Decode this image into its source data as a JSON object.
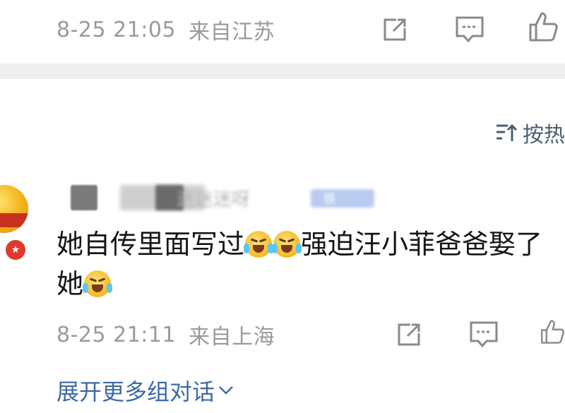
{
  "top_comment": {
    "date": "8-25 21:05",
    "location": "来自江苏"
  },
  "sort": {
    "label": "按热"
  },
  "comment": {
    "username": "迷迷迷呀",
    "tag": "铁粉",
    "text_line1": "她自传里面写过",
    "text_line1_tail": "强迫汪小菲爸爸娶了",
    "text_line2": "她",
    "date": "8-25 21:11",
    "location": "来自上海"
  },
  "expand_label": "展开更多组对话",
  "icons": {
    "share": "share-icon",
    "comment": "comment-icon",
    "like": "like-icon",
    "sort": "sort-icon",
    "emoji": "crying-laughing-emoji"
  },
  "colors": {
    "meta_text": "#9a9a9a",
    "link_blue": "#3d6aa6",
    "divider": "#eeeeee"
  }
}
